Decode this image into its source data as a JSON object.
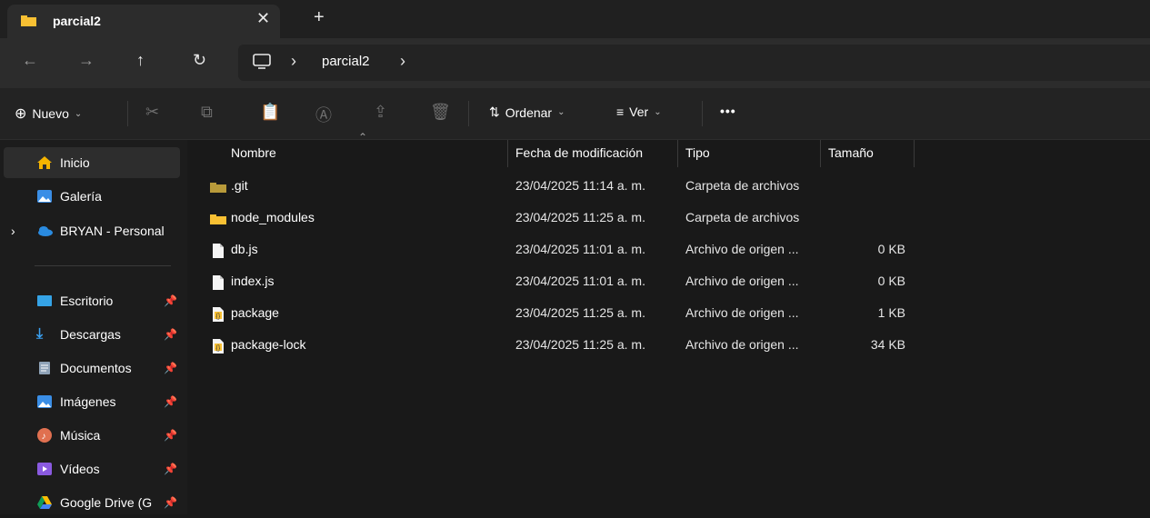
{
  "tab": {
    "title": "parcial2",
    "close": "✕",
    "new": "+"
  },
  "address": {
    "path": [
      "parcial2"
    ]
  },
  "toolbar": {
    "new_label": "Nuevo",
    "sort_label": "Ordenar",
    "view_label": "Ver",
    "more": "•••"
  },
  "sidebar": {
    "items": [
      {
        "label": "Inicio",
        "icon": "home-icon"
      },
      {
        "label": "Galería",
        "icon": "gallery-icon"
      },
      {
        "label": "BRYAN - Personal",
        "icon": "onedrive-icon"
      },
      {
        "label": "Escritorio",
        "icon": "desktop-icon"
      },
      {
        "label": "Descargas",
        "icon": "download-icon"
      },
      {
        "label": "Documentos",
        "icon": "documents-icon"
      },
      {
        "label": "Imágenes",
        "icon": "pictures-icon"
      },
      {
        "label": "Música",
        "icon": "music-icon"
      },
      {
        "label": "Vídeos",
        "icon": "videos-icon"
      },
      {
        "label": "Google Drive (G",
        "icon": "google-drive-icon"
      }
    ]
  },
  "columns": {
    "name": "Nombre",
    "date": "Fecha de modificación",
    "type": "Tipo",
    "size": "Tamaño"
  },
  "files": [
    {
      "name": ".git",
      "date": "23/04/2025 11:14 a. m.",
      "type": "Carpeta de archivos",
      "size": "",
      "icon": "folder-dark-icon"
    },
    {
      "name": "node_modules",
      "date": "23/04/2025 11:25 a. m.",
      "type": "Carpeta de archivos",
      "size": "",
      "icon": "folder-icon"
    },
    {
      "name": "db.js",
      "date": "23/04/2025 11:01 a. m.",
      "type": "Archivo de origen ...",
      "size": "0 KB",
      "icon": "file-icon"
    },
    {
      "name": "index.js",
      "date": "23/04/2025 11:01 a. m.",
      "type": "Archivo de origen ...",
      "size": "0 KB",
      "icon": "file-icon"
    },
    {
      "name": "package",
      "date": "23/04/2025 11:25 a. m.",
      "type": "Archivo de origen ...",
      "size": "1 KB",
      "icon": "json-file-icon"
    },
    {
      "name": "package-lock",
      "date": "23/04/2025 11:25 a. m.",
      "type": "Archivo de origen ...",
      "size": "34 KB",
      "icon": "json-file-icon"
    }
  ],
  "colors": {
    "folder": "#f8c033",
    "accent": "#4aa3f0"
  }
}
